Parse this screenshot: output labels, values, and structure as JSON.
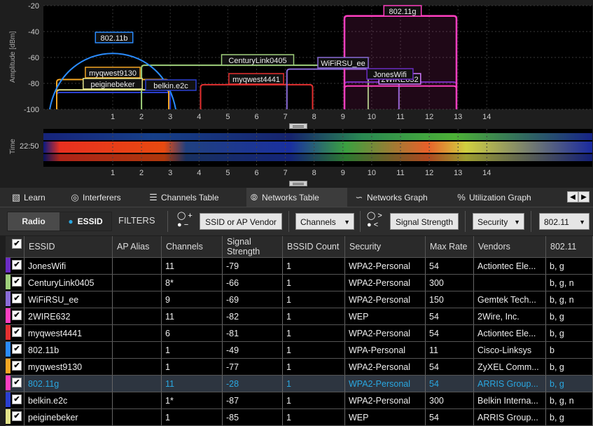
{
  "spectrum": {
    "y_axis_label": "Amplitude [dBm]",
    "y_ticks": [
      "-20",
      "-40",
      "-60",
      "-80",
      "-100"
    ],
    "x_ticks": [
      "1",
      "2",
      "3",
      "4",
      "5",
      "6",
      "7",
      "8",
      "9",
      "10",
      "11",
      "12",
      "13",
      "14"
    ],
    "labels": [
      {
        "text": "802.11g",
        "color": "#ff3fc0"
      },
      {
        "text": "802.11b",
        "color": "#2a8cff"
      },
      {
        "text": "CenturyLink0405",
        "color": "#9fd07c"
      },
      {
        "text": "WiFiRSU_ee",
        "color": "#8a6cd8"
      },
      {
        "text": "myqwest9130",
        "color": "#f5a623"
      },
      {
        "text": "myqwest4441",
        "color": "#e53030"
      },
      {
        "text": "peiginebeker",
        "color": "#e3e38a"
      },
      {
        "text": "belkin.e2c",
        "color": "#2a3fd0"
      },
      {
        "text": "2WIRE632",
        "color": "#d07bff"
      },
      {
        "text": "JonesWifi",
        "color": "#6b2cc4"
      }
    ]
  },
  "waterfall": {
    "y_axis_label": "Time",
    "time_label": "22:50",
    "x_ticks": [
      "1",
      "2",
      "3",
      "4",
      "5",
      "6",
      "7",
      "8",
      "9",
      "10",
      "11",
      "12",
      "13",
      "14"
    ]
  },
  "tabs": [
    {
      "label": "Learn",
      "icon": "book-icon"
    },
    {
      "label": "Interferers",
      "icon": "signal-icon"
    },
    {
      "label": "Channels Table",
      "icon": "list-icon"
    },
    {
      "label": "Networks Table",
      "icon": "wifi-icon"
    },
    {
      "label": "Networks Graph",
      "icon": "graph-icon"
    },
    {
      "label": "Utilization Graph",
      "icon": "percent-icon"
    }
  ],
  "filters": {
    "radio_label": "Radio",
    "essid_label": "ESSID",
    "filters_label": "FILTERS",
    "vendor_button": "SSID or AP Vendor",
    "channels_dd": "Channels",
    "signal_button": "Signal Strength",
    "security_dd": "Security",
    "standard_dd": "802.11",
    "plus": "+",
    "minus": "−",
    "gt": ">",
    "lt": "<"
  },
  "table": {
    "headers": [
      "ESSID",
      "AP Alias",
      "Channels",
      "Signal Strength",
      "BSSID Count",
      "Security",
      "Max Rate",
      "Vendors",
      "802.11"
    ],
    "rows": [
      {
        "color": "#6b2cc4",
        "essid": "JonesWifi",
        "alias": "",
        "channels": "11",
        "signal": "-79",
        "bssid": "1",
        "security": "WPA2-Personal",
        "rate": "54",
        "vendor": "Actiontec Ele...",
        "std": "b, g"
      },
      {
        "color": "#9fd07c",
        "essid": "CenturyLink0405",
        "alias": "",
        "channels": "8*",
        "signal": "-66",
        "bssid": "1",
        "security": "WPA2-Personal",
        "rate": "300",
        "vendor": "",
        "std": "b, g, n"
      },
      {
        "color": "#8a6cd8",
        "essid": "WiFiRSU_ee",
        "alias": "",
        "channels": "9",
        "signal": "-69",
        "bssid": "1",
        "security": "WPA2-Personal",
        "rate": "150",
        "vendor": "Gemtek Tech...",
        "std": "b, g, n"
      },
      {
        "color": "#ff3fc0",
        "essid": "2WIRE632",
        "alias": "",
        "channels": "11",
        "signal": "-82",
        "bssid": "1",
        "security": "WEP",
        "rate": "54",
        "vendor": "2Wire, Inc.",
        "std": "b, g"
      },
      {
        "color": "#e53030",
        "essid": "myqwest4441",
        "alias": "",
        "channels": "6",
        "signal": "-81",
        "bssid": "1",
        "security": "WPA2-Personal",
        "rate": "54",
        "vendor": "Actiontec Ele...",
        "std": "b, g"
      },
      {
        "color": "#2a8cff",
        "essid": "802.11b",
        "alias": "",
        "channels": "1",
        "signal": "-49",
        "bssid": "1",
        "security": "WPA-Personal",
        "rate": "11",
        "vendor": "Cisco-Linksys",
        "std": "b"
      },
      {
        "color": "#f5a623",
        "essid": "myqwest9130",
        "alias": "",
        "channels": "1",
        "signal": "-77",
        "bssid": "1",
        "security": "WPA2-Personal",
        "rate": "54",
        "vendor": "ZyXEL Comm...",
        "std": "b, g"
      },
      {
        "color": "#ff3fc0",
        "essid": "802.11g",
        "alias": "",
        "channels": "11",
        "signal": "-28",
        "bssid": "1",
        "security": "WPA2-Personal",
        "rate": "54",
        "vendor": "ARRIS Group...",
        "std": "b, g",
        "selected": true
      },
      {
        "color": "#2a3fd0",
        "essid": "belkin.e2c",
        "alias": "",
        "channels": "1*",
        "signal": "-87",
        "bssid": "1",
        "security": "WPA2-Personal",
        "rate": "300",
        "vendor": "Belkin Interna...",
        "std": "b, g, n"
      },
      {
        "color": "#e3e38a",
        "essid": "peiginebeker",
        "alias": "",
        "channels": "1",
        "signal": "-85",
        "bssid": "1",
        "security": "WEP",
        "rate": "54",
        "vendor": "ARRIS Group...",
        "std": "b, g"
      }
    ]
  }
}
